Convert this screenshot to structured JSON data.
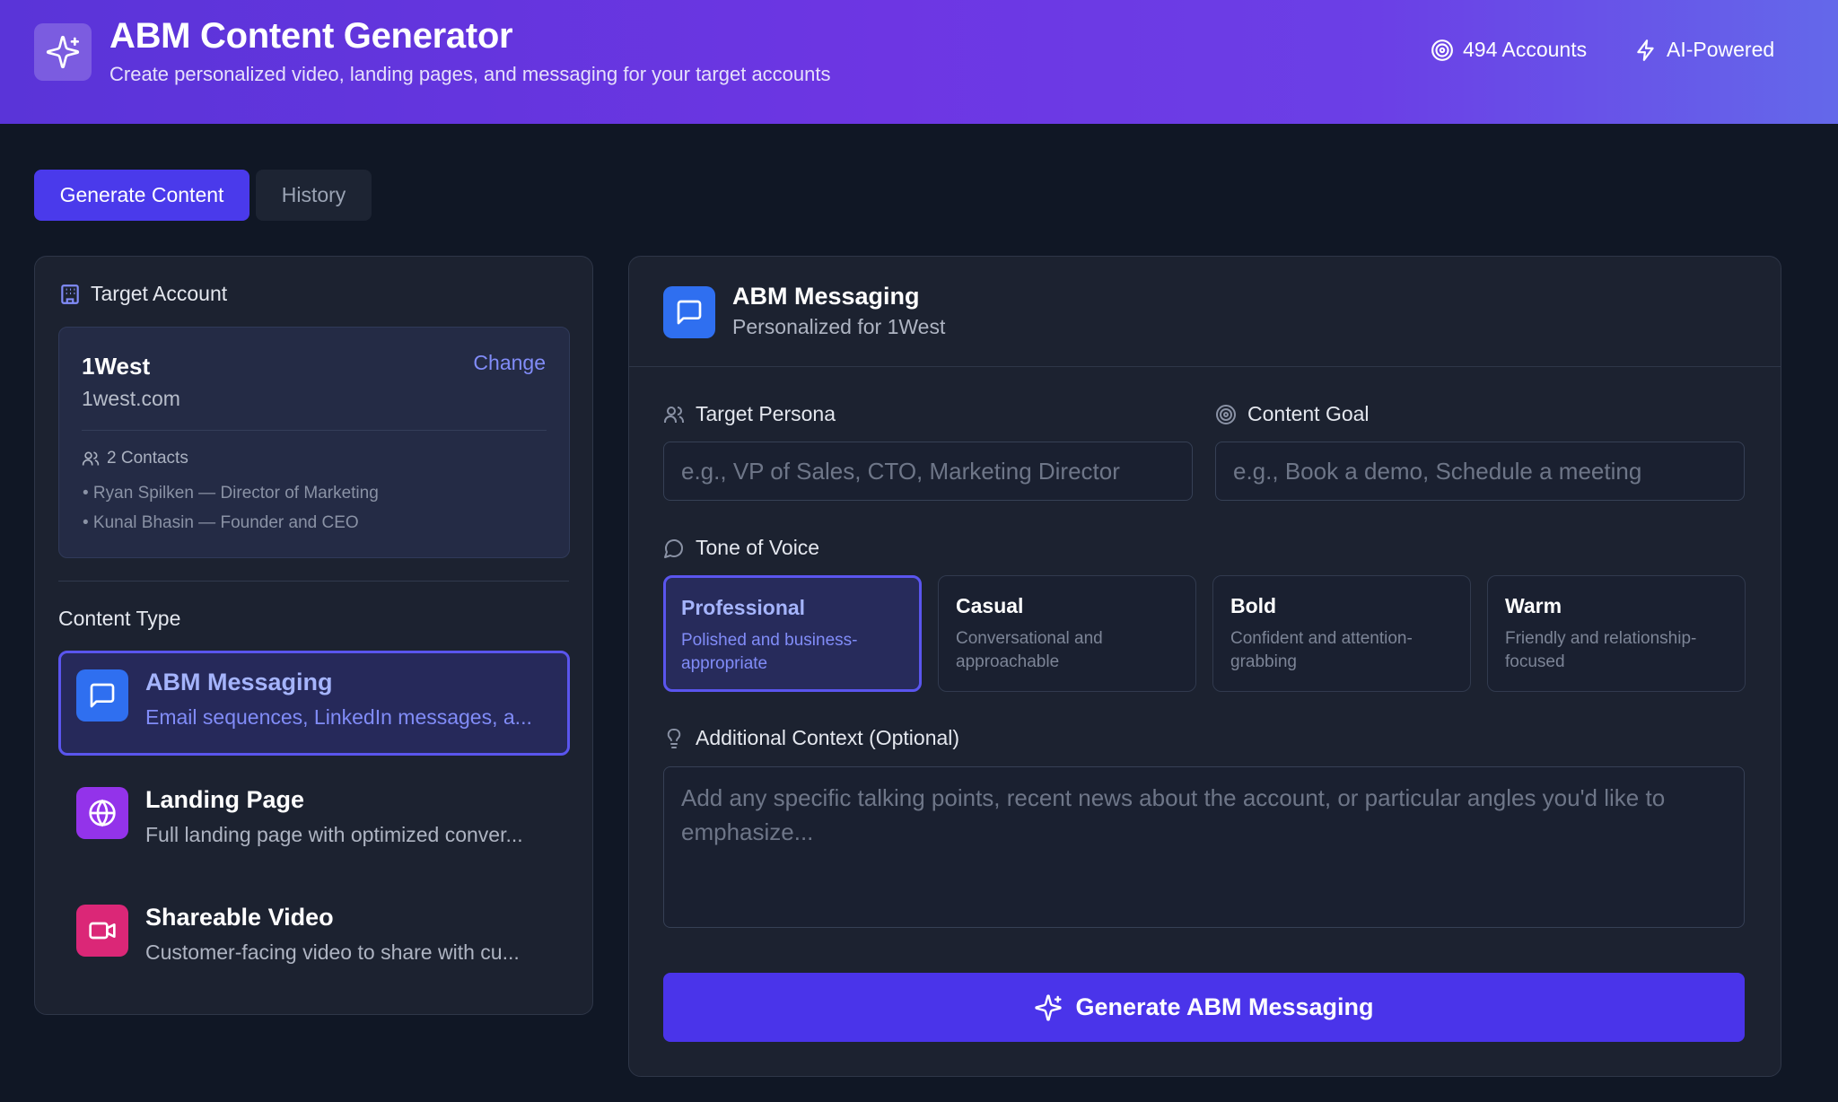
{
  "header": {
    "title": "ABM Content Generator",
    "subtitle": "Create personalized video, landing pages, and messaging for your target accounts",
    "accounts_stat": "494 Accounts",
    "ai_badge": "AI-Powered"
  },
  "tabs": [
    {
      "label": "Generate Content",
      "active": true
    },
    {
      "label": "History",
      "active": false
    }
  ],
  "target_account": {
    "heading": "Target Account",
    "name": "1West",
    "domain": "1west.com",
    "change_label": "Change",
    "contacts_label": "2 Contacts",
    "contacts": [
      "• Ryan Spilken — Director of Marketing",
      "• Kunal Bhasin — Founder and CEO"
    ]
  },
  "content_type": {
    "heading": "Content Type",
    "items": [
      {
        "name": "ABM Messaging",
        "description": "Email sequences, LinkedIn messages, a...",
        "icon": "message-square-icon",
        "color": "#2f6ff0",
        "selected": true
      },
      {
        "name": "Landing Page",
        "description": "Full landing page with optimized conver...",
        "icon": "globe-icon",
        "color": "#9333ea",
        "selected": false
      },
      {
        "name": "Shareable Video",
        "description": "Customer-facing video to share with cu...",
        "icon": "video-icon",
        "color": "#db2777",
        "selected": false
      }
    ]
  },
  "form": {
    "title": "ABM Messaging",
    "subtitle": "Personalized for 1West",
    "persona_label": "Target Persona",
    "persona_placeholder": "e.g., VP of Sales, CTO, Marketing Director",
    "persona_value": "",
    "goal_label": "Content Goal",
    "goal_placeholder": "e.g., Book a demo, Schedule a meeting",
    "goal_value": "",
    "tone_label": "Tone of Voice",
    "tones": [
      {
        "name": "Professional",
        "description": "Polished and business-appropriate",
        "selected": true
      },
      {
        "name": "Casual",
        "description": "Conversational and approachable",
        "selected": false
      },
      {
        "name": "Bold",
        "description": "Confident and attention-grabbing",
        "selected": false
      },
      {
        "name": "Warm",
        "description": "Friendly and relationship-focused",
        "selected": false
      }
    ],
    "context_label": "Additional Context (Optional)",
    "context_placeholder": "Add any specific talking points, recent news about the account, or particular angles you'd like to emphasize...",
    "context_value": "",
    "generate_label": "Generate ABM Messaging"
  },
  "colors": {
    "accent": "#4a3aeb",
    "selected_border": "#5a55ee",
    "selected_text": "#818cf8",
    "background": "#101725",
    "panel": "#1c2230"
  }
}
